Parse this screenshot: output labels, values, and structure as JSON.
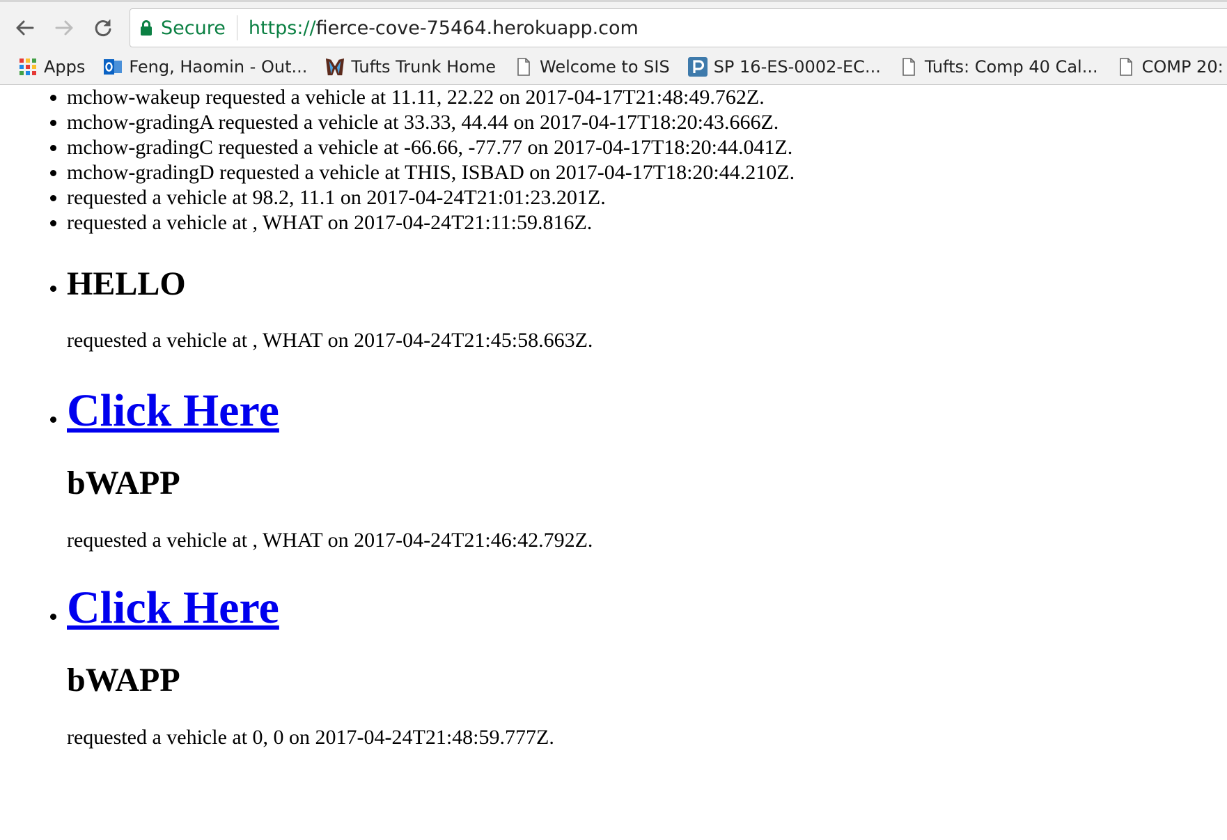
{
  "browser": {
    "secure_label": "Secure",
    "url_scheme": "https://",
    "url_host": "fierce-cove-75464.herokuapp.com",
    "bookmarks": [
      {
        "label": "Apps",
        "icon": "apps-grid-icon"
      },
      {
        "label": "Feng, Haomin - Out...",
        "icon": "outlook-icon"
      },
      {
        "label": "Tufts Trunk Home",
        "icon": "tufts-trunk-icon"
      },
      {
        "label": "Welcome to SIS",
        "icon": "page-icon"
      },
      {
        "label": "SP 16-ES-0002-EC...",
        "icon": "piazza-icon"
      },
      {
        "label": "Tufts: Comp 40 Cal...",
        "icon": "page-icon"
      },
      {
        "label": "COMP 20:",
        "icon": "page-icon"
      }
    ]
  },
  "requests": [
    "mchow-wakeup requested a vehicle at 11.11, 22.22 on 2017-04-17T21:48:49.762Z.",
    "mchow-gradingA requested a vehicle at 33.33, 44.44 on 2017-04-17T18:20:43.666Z.",
    "mchow-gradingC requested a vehicle at -66.66, -77.77 on 2017-04-17T18:20:44.041Z.",
    "mchow-gradingD requested a vehicle at THIS, ISBAD on 2017-04-17T18:20:44.210Z.",
    "requested a vehicle at 98.2, 11.1 on 2017-04-24T21:01:23.201Z.",
    "requested a vehicle at , WHAT on 2017-04-24T21:11:59.816Z."
  ],
  "blocks": {
    "hello": {
      "heading": "HELLO",
      "text": "requested a vehicle at , WHAT on 2017-04-24T21:45:58.663Z."
    },
    "link1": {
      "link": "Click Here",
      "heading": "bWAPP",
      "text": "requested a vehicle at , WHAT on 2017-04-24T21:46:42.792Z."
    },
    "link2": {
      "link": "Click Here",
      "heading": "bWAPP",
      "text": "requested a vehicle at 0, 0 on 2017-04-24T21:48:59.777Z."
    }
  },
  "colors": {
    "secure_green": "#0b8043",
    "link_blue": "#0000ee"
  }
}
